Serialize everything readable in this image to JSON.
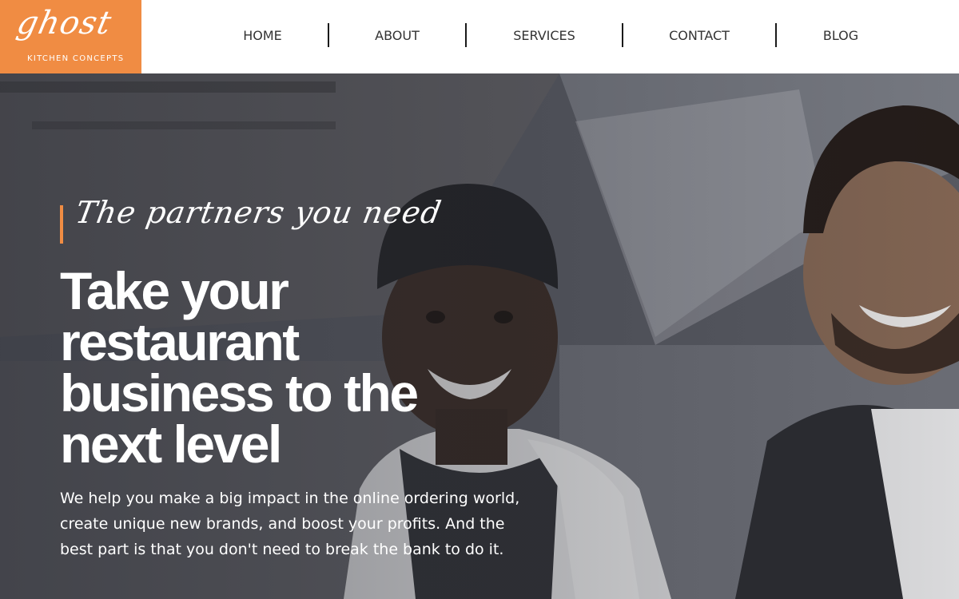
{
  "brand": {
    "logo_script": "ghost",
    "logo_sub": "KITCHEN CONCEPTS",
    "accent_color": "#f08c43"
  },
  "nav": {
    "items": [
      {
        "label": "HOME"
      },
      {
        "label": "ABOUT"
      },
      {
        "label": "SERVICES"
      },
      {
        "label": "CONTACT"
      },
      {
        "label": "BLOG"
      }
    ]
  },
  "hero": {
    "tagline": "The partners you need",
    "headline": "Take your restaurant business to the next level",
    "body": "We help you make a big impact in the online ordering world, create unique new brands, and boost your profits. And the best part is that you don't need to break the bank to do it.",
    "image": "photo-icon"
  }
}
